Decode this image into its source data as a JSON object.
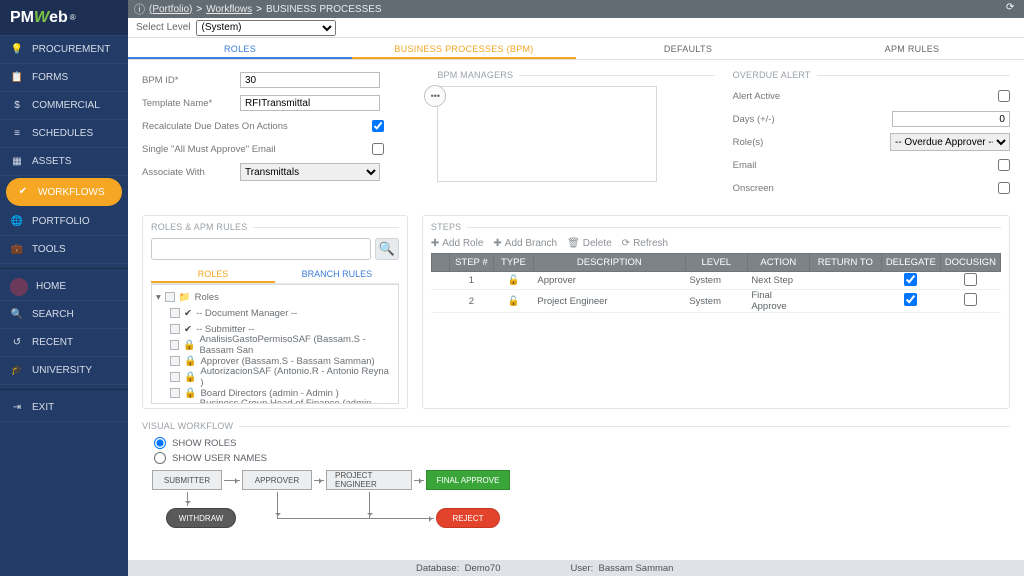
{
  "brand": {
    "p": "PM",
    "w": "W",
    "eb": "eb",
    "reg": "®"
  },
  "sidebar": {
    "items": [
      {
        "icon": "💡",
        "label": "PROCUREMENT"
      },
      {
        "icon": "📋",
        "label": "FORMS"
      },
      {
        "icon": "$",
        "label": "COMMERCIAL"
      },
      {
        "icon": "≡",
        "label": "SCHEDULES"
      },
      {
        "icon": "▦",
        "label": "ASSETS"
      },
      {
        "icon": "✔",
        "label": "WORKFLOWS",
        "active": true
      },
      {
        "icon": "🌐",
        "label": "PORTFOLIO"
      },
      {
        "icon": "💼",
        "label": "TOOLS"
      }
    ],
    "lower": [
      {
        "icon": "avatar",
        "label": "HOME"
      },
      {
        "icon": "🔍",
        "label": "SEARCH"
      },
      {
        "icon": "↺",
        "label": "RECENT"
      },
      {
        "icon": "🎓",
        "label": "UNIVERSITY"
      }
    ],
    "exit": {
      "icon": "⇥",
      "label": "EXIT"
    }
  },
  "breadcrumb": {
    "portfolio": "(Portfolio)",
    "sep": ">",
    "a": "Workflows",
    "b": "BUSINESS PROCESSES"
  },
  "level": {
    "label": "Select Level",
    "value": "(System)"
  },
  "tabs": [
    "ROLES",
    "BUSINESS PROCESSES (BPM)",
    "DEFAULTS",
    "APM RULES"
  ],
  "form": {
    "bpmid": {
      "label": "BPM ID*",
      "value": "30"
    },
    "tmpl": {
      "label": "Template Name*",
      "value": "RFITransmittal"
    },
    "recalc": {
      "label": "Recalculate Due Dates On Actions",
      "value": true
    },
    "single": {
      "label": "Single \"All Must Approve\" Email",
      "value": false
    },
    "assoc": {
      "label": "Associate With",
      "value": "Transmittals"
    }
  },
  "managers": {
    "title": "BPM MANAGERS"
  },
  "overdue": {
    "title": "OVERDUE ALERT",
    "active": {
      "label": "Alert Active",
      "value": false
    },
    "days": {
      "label": "Days (+/-)",
      "value": "0"
    },
    "roles": {
      "label": "Role(s)",
      "value": "-- Overdue Approver --"
    },
    "email": {
      "label": "Email",
      "value": false
    },
    "onscreen": {
      "label": "Onscreen",
      "value": false
    }
  },
  "roles_apm": {
    "title": "ROLES & APM RULES",
    "subtabs": [
      "ROLES",
      "BRANCH RULES"
    ],
    "root": "Roles",
    "items": [
      {
        "chk": true,
        "label": "-- Document Manager --"
      },
      {
        "chk": true,
        "label": "-- Submitter --"
      },
      {
        "chk": false,
        "lock": true,
        "label": "AnalisisGastoPermisoSAF (Bassam.S - Bassam San"
      },
      {
        "chk": false,
        "lock": true,
        "label": "Approver (Bassam.S - Bassam Samman)"
      },
      {
        "chk": false,
        "lock": true,
        "label": "AutorizacionSAF (Antonio.R - Antonio Reyna )"
      },
      {
        "chk": false,
        "lock": true,
        "label": "Board Directors (admin - Admin )"
      },
      {
        "chk": false,
        "lock": true,
        "label": "Business Group Head of Finance (admin - Admin )"
      }
    ]
  },
  "steps": {
    "title": "STEPS",
    "tools": {
      "addRole": "Add Role",
      "addBranch": "Add Branch",
      "del": "Delete",
      "refresh": "Refresh"
    },
    "headers": [
      "",
      "STEP #",
      "TYPE",
      "DESCRIPTION",
      "LEVEL",
      "ACTION",
      "RETURN TO",
      "DELEGATE",
      "DOCUSIGN"
    ],
    "rows": [
      {
        "n": "1",
        "desc": "Approver",
        "level": "System",
        "action": "Next Step",
        "del": true,
        "doc": false
      },
      {
        "n": "2",
        "desc": "Project Engineer",
        "level": "System",
        "action": "Final Approve",
        "del": true,
        "doc": false
      }
    ]
  },
  "visual": {
    "title": "VISUAL WORKFLOW",
    "showRoles": "SHOW ROLES",
    "showUsers": "SHOW USER NAMES",
    "nodes": {
      "submitter": "SUBMITTER",
      "approver": "APPROVER",
      "pe": "PROJECT ENGINEER",
      "fa": "FINAL APPROVE",
      "withdraw": "WITHDRAW",
      "reject": "REJECT"
    }
  },
  "status": {
    "dbL": "Database:",
    "db": "Demo70",
    "usrL": "User:",
    "usr": "Bassam Samman"
  }
}
